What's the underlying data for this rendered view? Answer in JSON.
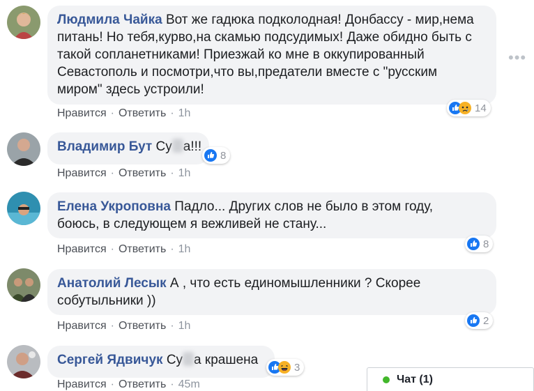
{
  "comments": [
    {
      "author": "Людмила Чайка",
      "text": "Вот же гадюка подколодная! Донбассу - мир,нема питань! Но тебя,курво,на скамью подсудимых! Даже обидно быть с такой сопланетниками! Приезжай ко мне в оккупированный Севастополь и посмотри,что вы,предатели вместе с \"русским миром\" здесь устроили!",
      "line1": "Вот же гадюка подколодная! Донбассу - мир,нема",
      "line2": "питань! Но тебя,курво,на скамью подсудимых! Даже обидно быть с",
      "line3": "такой сопланетниками! Приезжай ко мне в оккупированный",
      "line4": "Севастополь и посмотри,что вы,предатели вместе с \"русским",
      "line5": "миром\" здесь устроили!",
      "like": "Нравится",
      "reply": "Ответить",
      "time": "1h",
      "reactions": [
        "like",
        "sad"
      ],
      "count": "14"
    },
    {
      "author": "Владимир Бут",
      "text_a": "Су",
      "text_b": "а!!!",
      "like": "Нравится",
      "reply": "Ответить",
      "time": "1h",
      "reactions": [
        "like"
      ],
      "count": "8"
    },
    {
      "author": "Елена Укроповна",
      "line1": "Падло... Других слов не было в этом году,",
      "line2": "боюсь, в следующем я вежливей не стану...",
      "like": "Нравится",
      "reply": "Ответить",
      "time": "1h",
      "reactions": [
        "like"
      ],
      "count": "8"
    },
    {
      "author": "Анатолий Лесык",
      "line1": "А , что есть единомышленники ? Скорее",
      "line2": "собутыльники ))",
      "like": "Нравится",
      "reply": "Ответить",
      "time": "1h",
      "reactions": [
        "like"
      ],
      "count": "2"
    },
    {
      "author": "Сергей Ядвичук",
      "text_a": "Су",
      "text_b": "а крашена",
      "like": "Нравится",
      "reply": "Ответить",
      "time": "45m",
      "reactions": [
        "like",
        "haha"
      ],
      "count": "3"
    }
  ],
  "more": "•••",
  "chat": {
    "label": "Чат (1)"
  },
  "colors": {
    "author": "#385898",
    "bubble": "#f2f3f5",
    "like": "#1877f2",
    "online": "#42b72a"
  }
}
